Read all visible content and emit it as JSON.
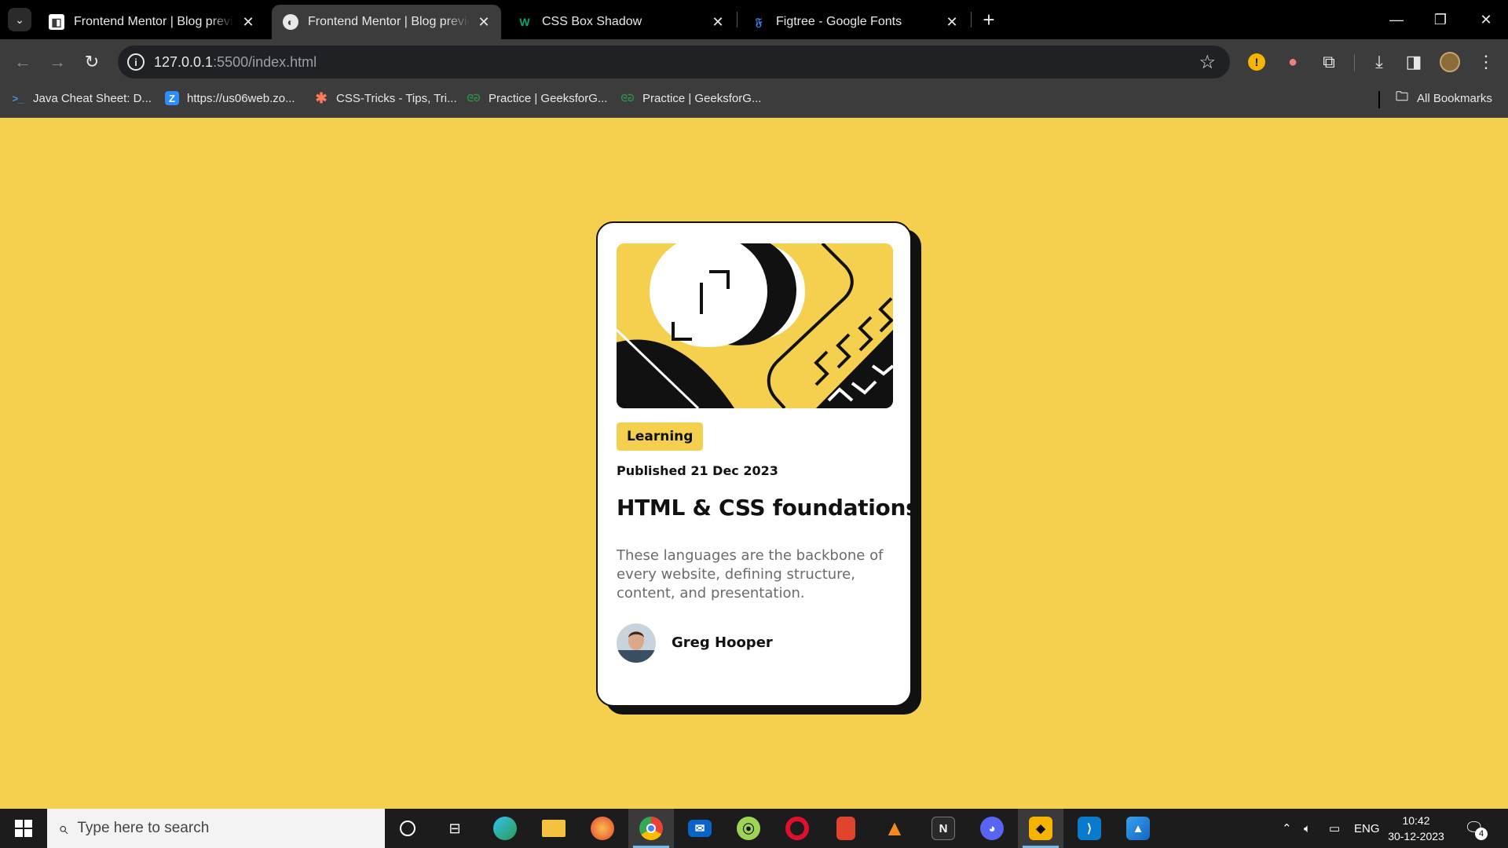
{
  "browser": {
    "tabs": [
      {
        "title": "Frontend Mentor | Blog preview card",
        "favicon": "frontend-mentor-icon",
        "active": false
      },
      {
        "title": "Frontend Mentor | Blog preview card",
        "favicon": "page-icon",
        "active": true
      },
      {
        "title": "CSS Box Shadow",
        "favicon": "w3schools-icon",
        "active": false
      },
      {
        "title": "Figtree - Google Fonts",
        "favicon": "google-fonts-icon",
        "active": false
      }
    ],
    "close_glyph": "✕",
    "new_tab_glyph": "+",
    "url_host": "127.0.0.1",
    "url_path": ":5500/index.html",
    "bookmarks": [
      {
        "label": "Java Cheat Sheet: D...",
        "icon": "terminal-icon"
      },
      {
        "label": "https://us06web.zo...",
        "icon": "zoom-icon"
      },
      {
        "label": "CSS-Tricks - Tips, Tri...",
        "icon": "css-tricks-icon"
      },
      {
        "label": "Practice | GeeksforG...",
        "icon": "geeksforgeeks-icon"
      },
      {
        "label": "Practice | GeeksforG...",
        "icon": "geeksforgeeks-icon"
      }
    ],
    "all_bookmarks": "All Bookmarks"
  },
  "card": {
    "tag": "Learning",
    "published": "Published 21 Dec 2023",
    "title": "HTML & CSS foundations",
    "excerpt": "These languages are the backbone of every website, defining structure, content, and presentation.",
    "author": "Greg Hooper"
  },
  "taskbar": {
    "search_placeholder": "Type here to search",
    "apps": [
      "cortana-icon",
      "task-view-icon",
      "edge-icon",
      "file-explorer-icon",
      "firefox-icon",
      "chrome-icon",
      "mail-icon",
      "xbox-game-bar-icon",
      "opera-icon",
      "office-icon",
      "vlc-icon",
      "notion-icon",
      "discord-icon",
      "brave-icon",
      "vscode-icon",
      "photos-icon"
    ],
    "language": "ENG",
    "time": "10:42",
    "date": "30-12-2023",
    "notifications": "4"
  },
  "colors": {
    "page_background": "#f4d04e",
    "card_background": "#ffffff",
    "card_shadow": "#111111",
    "excerpt_text": "#6b6b6b"
  }
}
